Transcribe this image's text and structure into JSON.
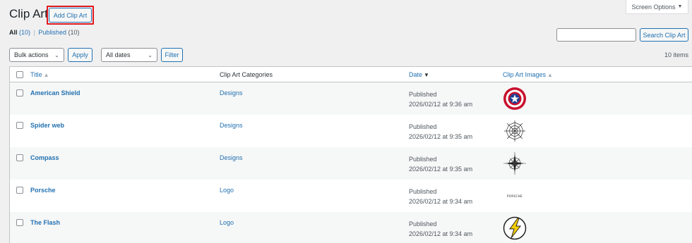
{
  "screen_options": {
    "label": "Screen Options",
    "arrow": "▼"
  },
  "page": {
    "title": "Clip Art",
    "add_button": "Add Clip Art"
  },
  "filters": {
    "all": "All",
    "all_count": "(10)",
    "separator": "|",
    "published": "Published",
    "published_count": "(10)"
  },
  "search": {
    "placeholder": "",
    "button": "Search Clip Art"
  },
  "toolbar": {
    "bulk_actions": "Bulk actions",
    "apply": "Apply",
    "dates": "All dates",
    "filter": "Filter",
    "items_count": "10 items"
  },
  "table": {
    "headers": {
      "title": "Title",
      "categories": "Clip Art Categories",
      "date": "Date",
      "images": "Clip Art Images"
    },
    "rows": [
      {
        "title": "American Shield",
        "category": "Designs",
        "status": "Published",
        "date": "2026/02/12 at 9:36 am",
        "image": "captain-america-shield-icon"
      },
      {
        "title": "Spider web",
        "category": "Designs",
        "status": "Published",
        "date": "2026/02/12 at 9:35 am",
        "image": "spider-web-icon"
      },
      {
        "title": "Compass",
        "category": "Designs",
        "status": "Published",
        "date": "2026/02/12 at 9:35 am",
        "image": "compass-icon"
      },
      {
        "title": "Porsche",
        "category": "Logo",
        "status": "Published",
        "date": "2026/02/12 at 9:34 am",
        "image": "porsche-logo",
        "image_text": "PORSCHE"
      },
      {
        "title": "The Flash",
        "category": "Logo",
        "status": "Published",
        "date": "2026/02/12 at 9:34 am",
        "image": "flash-lightning-icon"
      }
    ]
  },
  "colors": {
    "link": "#2271b1",
    "background": "#f0f0f1",
    "highlight": "#e0191f",
    "shield_red": "#c8102e",
    "shield_blue": "#1c3f94",
    "flash_yellow": "#f5d000"
  }
}
